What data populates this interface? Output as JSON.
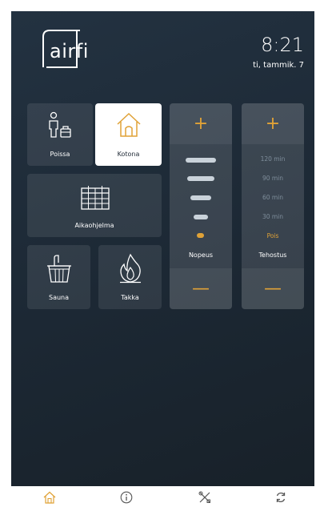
{
  "header": {
    "logo_text": "airfi",
    "time": "8:21",
    "date": "ti, tammik. 7"
  },
  "modes": {
    "away_label": "Poissa",
    "home_label": "Kotona",
    "schedule_label": "Aikaohjelma",
    "sauna_label": "Sauna",
    "fireplace_label": "Takka",
    "active": "Kotona"
  },
  "speed": {
    "label": "Nopeus",
    "plus": "+",
    "minus": "—",
    "levels": 5,
    "current_level": 1
  },
  "boost": {
    "label": "Tehostus",
    "plus": "+",
    "minus": "—",
    "options": [
      "120 min",
      "90 min",
      "60 min",
      "30 min",
      "Pois"
    ],
    "selected": "Pois"
  },
  "nav": {
    "items": [
      "home-icon",
      "info-icon",
      "tools-icon",
      "refresh-icon"
    ]
  },
  "colors": {
    "accent": "#e0a237",
    "background": "#1f2a36",
    "tile": "#2e3b47",
    "active_tile": "#ffffff"
  }
}
